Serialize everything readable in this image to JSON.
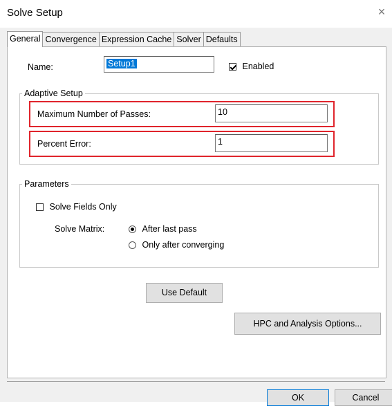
{
  "window": {
    "title": "Solve Setup",
    "close_glyph": "×"
  },
  "tabs": [
    {
      "label": "General",
      "active": true
    },
    {
      "label": "Convergence",
      "active": false
    },
    {
      "label": "Expression Cache",
      "active": false
    },
    {
      "label": "Solver",
      "active": false
    },
    {
      "label": "Defaults",
      "active": false
    }
  ],
  "general": {
    "name_label": "Name:",
    "name_value": "Setup1",
    "enabled_label": "Enabled",
    "enabled_checked": true
  },
  "adaptive": {
    "group_label": "Adaptive Setup",
    "max_passes_label": "Maximum Number of Passes:",
    "max_passes_value": "10",
    "percent_error_label": "Percent Error:",
    "percent_error_value": "1"
  },
  "parameters": {
    "group_label": "Parameters",
    "solve_fields_only_label": "Solve Fields Only",
    "solve_fields_only_checked": false,
    "solve_matrix_label": "Solve Matrix:",
    "options": [
      {
        "label": "After last pass",
        "selected": true
      },
      {
        "label": "Only after converging",
        "selected": false
      }
    ]
  },
  "buttons": {
    "use_default": "Use Default",
    "hpc": "HPC and Analysis Options...",
    "ok": "OK",
    "cancel": "Cancel"
  },
  "colors": {
    "highlight": "#e0242c",
    "selection": "#0078d7"
  }
}
